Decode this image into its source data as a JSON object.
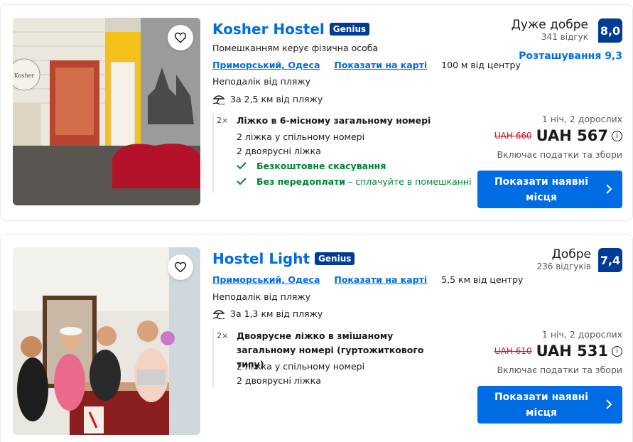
{
  "cards": [
    {
      "name": "Kosher Hostel",
      "genius": "Genius",
      "managed_by": "Помешканням керує фізична особа",
      "district": "Приморський, Одеса",
      "show_on_map": "Показати на карті",
      "distance_center": "100 м від центру",
      "near_beach": "Неподалік від пляжу",
      "beach_distance": "За 2,5 км від пляжу",
      "room_multiplier": "2×",
      "room_title": "Ліжко в 6-місному загальному номері",
      "beds_line1": "2 ліжка у спільному номері",
      "beds_line2": "2 двоярусні ліжка",
      "free_cancel": "Безкоштовне скасування",
      "no_prepay": "Без передоплати",
      "pay_at_property": " – сплачуйте в помешканні",
      "rating_word": "Дуже добре",
      "reviews": "341 відгук",
      "score": "8,0",
      "location_label": "Розташування 9,3",
      "stay": "1 ніч, 2 дорослих",
      "old_price": "UAH 660",
      "price": "UAH 567",
      "taxes": "Включає податки та збори",
      "cta": "Показати наявні місця"
    },
    {
      "name": "Hostel Light",
      "genius": "Genius",
      "district": "Приморський, Одеса",
      "show_on_map": "Показати на карті",
      "distance_center": "5,5 км від центру",
      "near_beach": "Неподалік від пляжу",
      "beach_distance": "За 1,3 км від пляжу",
      "room_multiplier": "2×",
      "room_title": "Двоярусне ліжко в змішаному загальному номері (гуртожиткового типу)",
      "beds_line1": "2 ліжка у спільному номері",
      "beds_line2": "2 двоярусні ліжка",
      "rating_word": "Добре",
      "reviews": "236 відгуків",
      "score": "7,4",
      "stay": "1 ніч, 2 дорослих",
      "old_price": "UAH 610",
      "price": "UAH 531",
      "taxes": "Включає податки та збори",
      "cta": "Показати наявні місця"
    }
  ],
  "icons": {
    "favorite": "heart-icon",
    "beach": "beach-umbrella-icon",
    "check": "checkmark-icon",
    "info": "info-icon",
    "chevron": "chevron-right-icon"
  },
  "colors": {
    "link_blue": "#006ce4",
    "score_navy": "#003b95",
    "green": "#008234",
    "strike_red": "#d4111e"
  }
}
